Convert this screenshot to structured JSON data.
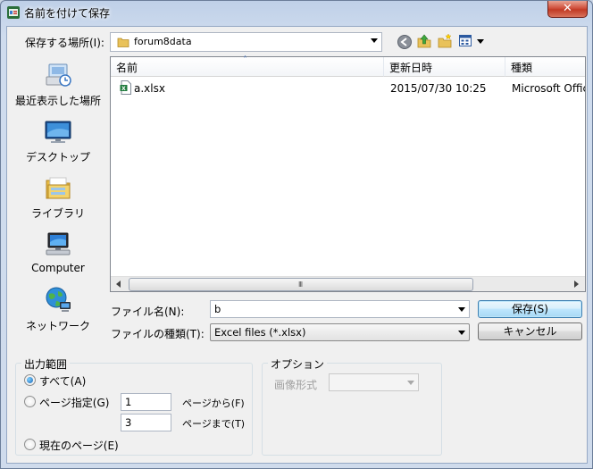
{
  "window": {
    "title": "名前を付けて保存",
    "close_label": "✕"
  },
  "save_in": {
    "label": "保存する場所(I):",
    "value": "forum8data"
  },
  "places": [
    {
      "label": "最近表示した場所",
      "icon": "recent-places-icon"
    },
    {
      "label": "デスクトップ",
      "icon": "desktop-icon"
    },
    {
      "label": "ライブラリ",
      "icon": "libraries-icon"
    },
    {
      "label": "Computer",
      "icon": "computer-icon"
    },
    {
      "label": "ネットワーク",
      "icon": "network-icon"
    }
  ],
  "file_list": {
    "columns": [
      "名前",
      "更新日時",
      "種類"
    ],
    "rows": [
      {
        "name": "a.xlsx",
        "modified": "2015/07/30 10:25",
        "type": "Microsoft Office",
        "icon": "excel-file-icon"
      }
    ],
    "scroll_grip": "III"
  },
  "file_name": {
    "label": "ファイル名(N):",
    "value": "b"
  },
  "file_type": {
    "label": "ファイルの種類(T):",
    "value": "Excel files (*.xlsx)"
  },
  "buttons": {
    "save": "保存(S)",
    "cancel": "キャンセル"
  },
  "output_range": {
    "title": "出力範囲",
    "all_label": "すべて(A)",
    "pages_label": "ページ指定(G)",
    "current_label": "現在のページ(E)",
    "from_value": "1",
    "to_value": "3",
    "from_suffix": "ページから(F)",
    "to_suffix": "ページまで(T)",
    "selected": "all"
  },
  "options": {
    "title": "オプション",
    "image_format_label": "画像形式",
    "image_format_value": ""
  },
  "colors": {
    "accent": "#3c7fb1",
    "title_bar": "#bfd0e8",
    "close_button": "#c13a24"
  }
}
